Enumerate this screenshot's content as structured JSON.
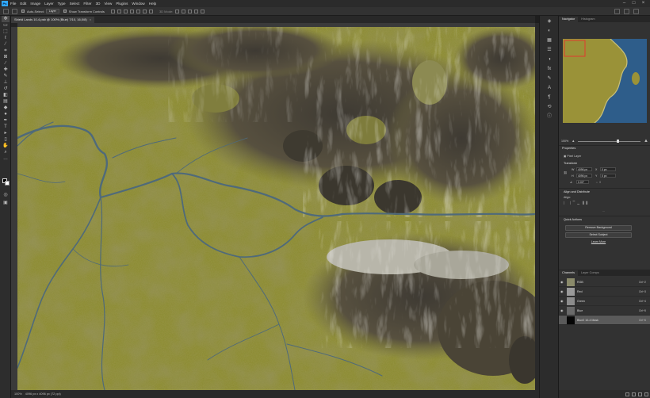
{
  "menubar": {
    "logo": "Ps",
    "items": [
      "File",
      "Edit",
      "Image",
      "Layer",
      "Type",
      "Select",
      "Filter",
      "3D",
      "View",
      "Plugins",
      "Window",
      "Help"
    ]
  },
  "options": {
    "auto_select_label": "Auto-Select:",
    "auto_select_value": "Layer",
    "show_transform_label": "Show Transform Controls",
    "mode_3d_label": "3D Mode:"
  },
  "document": {
    "tab_title": "Shield Lands 10-4.psb @ 100% (Blue) 7/10, 16,0/8)",
    "status_zoom": "100%",
    "status_info": "4096 px x 4096 px (72 ppi)"
  },
  "panels": {
    "top_tabs": [
      "Navigator",
      "Histogram"
    ],
    "nav_zoom": "100%",
    "nav_zoom_fraction": 0.62,
    "properties": {
      "title": "Properties",
      "layer_kind": "Pixel Layer",
      "transform_title": "Transform",
      "w_label": "W",
      "w_value": "4096 px",
      "x_label": "X",
      "x_value": "0 px",
      "h_label": "H",
      "h_value": "4096 px",
      "y_label": "Y",
      "y_value": "0 px",
      "angle_value": "0.00°",
      "align_title": "Align and Distribute",
      "align_label": "Align:",
      "more": "...",
      "quick_actions_title": "Quick Actions",
      "remove_bg": "Remove Background",
      "select_subject": "Select Subject",
      "learn_more": "Learn More"
    },
    "channels": {
      "tabs": [
        "Channels",
        "Layer Comps"
      ],
      "rows": [
        {
          "name": "RGB",
          "shortcut": "Ctrl+2",
          "thumb": "#8a8a6a"
        },
        {
          "name": "Red",
          "shortcut": "Ctrl+3",
          "thumb": "#9a9a9a"
        },
        {
          "name": "Green",
          "shortcut": "Ctrl+4",
          "thumb": "#8c8c8c"
        },
        {
          "name": "Blue",
          "shortcut": "Ctrl+5",
          "thumb": "#6a6a6a"
        },
        {
          "name": "Blue2 10-4 Mask",
          "shortcut": "Ctrl+6",
          "thumb": "#050505"
        }
      ]
    }
  },
  "colors": {
    "terrain_base": "#8a8a2e",
    "terrain_dark": "#5e5a28",
    "mountain": "#5a5245",
    "snow": "#d8d6cc",
    "river": "#4f6a7a",
    "sea": "#2e5d8a",
    "accent": "#31a8ff"
  },
  "icons": [
    "move-tool-icon",
    "marquee-tool-icon",
    "lasso-tool-icon",
    "crop-tool-icon",
    "brush-tool-icon",
    "eraser-tool-icon",
    "type-tool-icon",
    "hand-tool-icon",
    "zoom-tool-icon"
  ]
}
